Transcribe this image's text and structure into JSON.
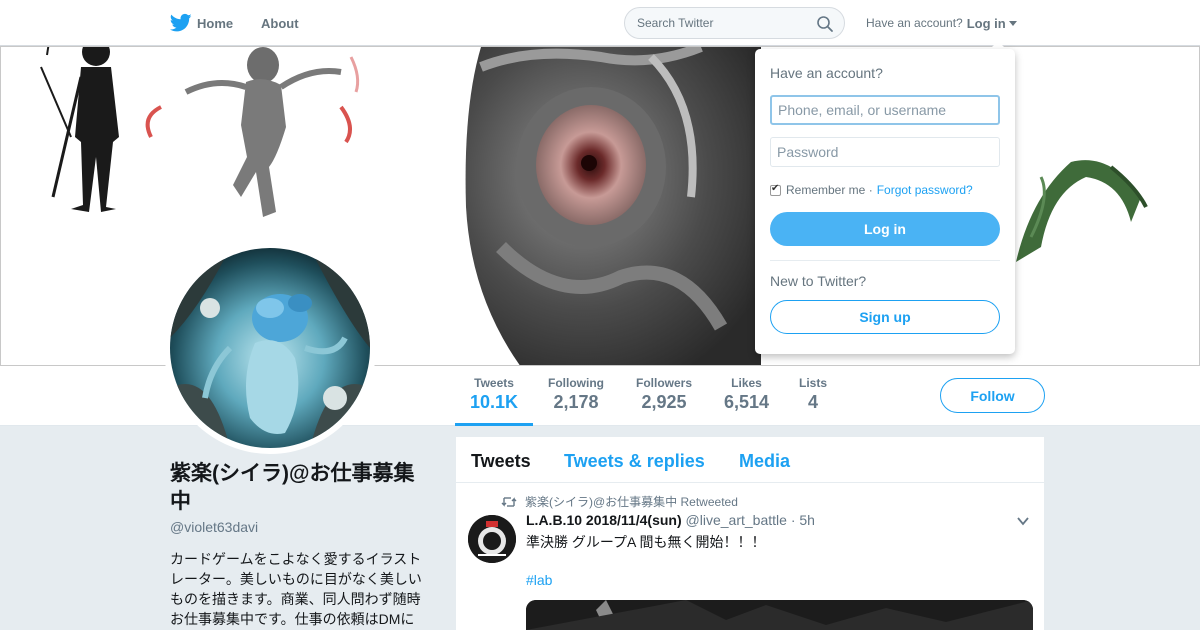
{
  "nav": {
    "home_label": "Home",
    "about_label": "About",
    "search_placeholder": "Search Twitter",
    "have_account": "Have an account?",
    "login_label": "Log in"
  },
  "profile": {
    "display_name": "紫楽(シイラ)@お仕事募集中",
    "screen_name": "@violet63davi",
    "bio": "カードゲームをこよなく愛するイラストレーター。美しいものに目がなく美しいものを描きます。商業、同人問わず随時お仕事募集中です。仕事の依頼はDMに"
  },
  "stats": [
    {
      "label": "Tweets",
      "value": "10.1K",
      "active": true
    },
    {
      "label": "Following",
      "value": "2,178"
    },
    {
      "label": "Followers",
      "value": "2,925"
    },
    {
      "label": "Likes",
      "value": "6,514"
    },
    {
      "label": "Lists",
      "value": "4"
    }
  ],
  "follow_label": "Follow",
  "timeline": {
    "tabs": [
      "Tweets",
      "Tweets & replies",
      "Media"
    ],
    "tweet": {
      "retweet_context": "紫楽(シイラ)@お仕事募集中 Retweeted",
      "author": "L.A.B.10 2018/11/4(sun)",
      "handle": "@live_art_battle",
      "time": "· 5h",
      "text": "準決勝 グループA 間も無く開始！！！",
      "hashtag": "#lab"
    }
  },
  "login_dropdown": {
    "title": "Have an account?",
    "username_placeholder": "Phone, email, or username",
    "password_placeholder": "Password",
    "remember_label": "Remember me ·",
    "forgot_label": "Forgot password?",
    "login_button": "Log in",
    "new_label": "New to Twitter?",
    "signup_button": "Sign up"
  },
  "colors": {
    "accent": "#1da1f2",
    "login_button_bg": "#4ab3f4",
    "page_bg": "#e6ecf0"
  }
}
